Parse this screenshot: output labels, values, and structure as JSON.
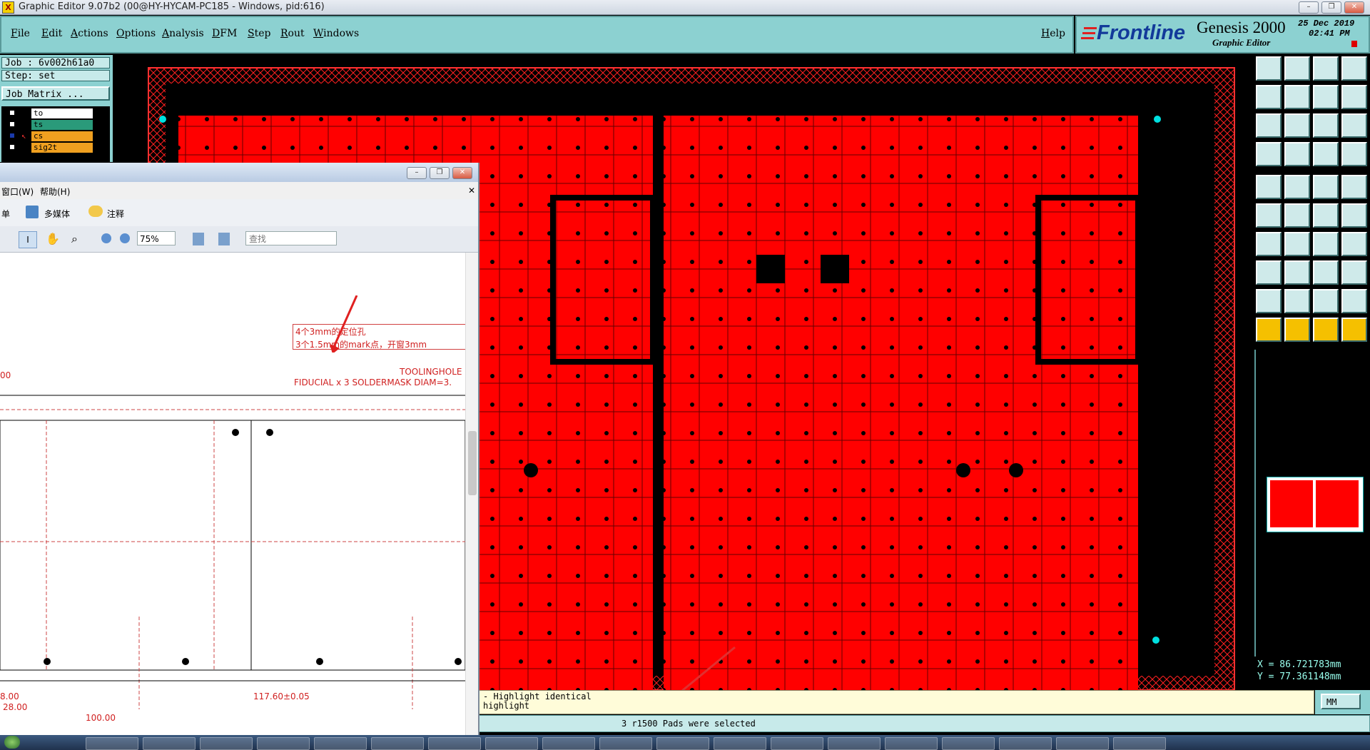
{
  "window": {
    "title": "Graphic Editor 9.07b2 (00@HY-HYCAM-PC185 - Windows, pid:616)"
  },
  "menu": {
    "items": [
      "File",
      "Edit",
      "Actions",
      "Options",
      "Analysis",
      "DFM",
      "Step",
      "Rout",
      "Windows"
    ],
    "help": "Help"
  },
  "brand": {
    "logo": "Frontline",
    "product": "Genesis 2000",
    "subtitle": "Graphic Editor",
    "date": "25 Dec 2019",
    "time": "02:41 PM"
  },
  "job": {
    "job_line": "Job : 6v002h61a0",
    "step_line": "Step: set",
    "matrix_button": "Job Matrix ..."
  },
  "layers": [
    {
      "name": "to",
      "color": "#ffffff"
    },
    {
      "name": "ts",
      "color": "#2a9a7a"
    },
    {
      "name": "cs",
      "color": "#f0a020"
    },
    {
      "name": "sig2t",
      "color": "#f0a020"
    }
  ],
  "pdf": {
    "menu": [
      "窗口(W)",
      "帮助(H)"
    ],
    "toolbar": {
      "left_item": "单",
      "multimedia": "多媒体",
      "annotation": "注释"
    },
    "zoom": "75%",
    "search_placeholder": "查找",
    "note_line1": "4个3mm的定位孔",
    "note_line2": "3个1.5mm的mark点，开窗3mm",
    "label_tooling": "TOOLINGHOLE",
    "label_fiducial": "FIDUCIAL x 3 SOLDERMASK DIAM=3.",
    "dim_a": "8.00",
    "dim_b": "28.00",
    "dim_c": "100.00",
    "dim_d": "117.60±0.05",
    "dim_e": "00"
  },
  "messages": {
    "line1": "- Highlight identical",
    "line2": "highlight",
    "status": "3 r1500 Pads were selected"
  },
  "coords": {
    "x": "X = 86.721783mm",
    "y": "Y = 77.361148mm"
  },
  "units": {
    "label": "MM"
  },
  "colors": {
    "panel": "#8cd1d1",
    "board": "#ff0000",
    "message_bg": "#fffcd9"
  }
}
